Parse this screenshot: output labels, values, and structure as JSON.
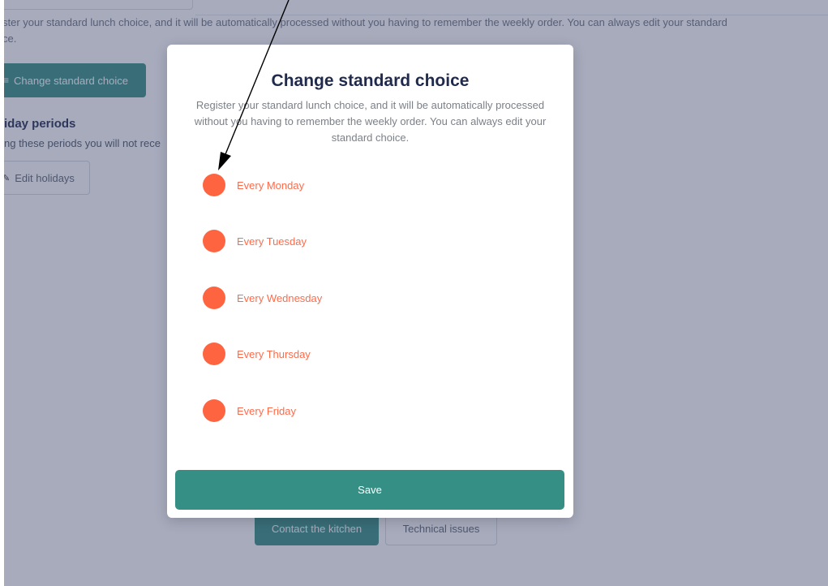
{
  "background": {
    "intro_line1": "ster your standard lunch choice, and it will be automatically processed without you having to remember the weekly order. You can always edit your standard",
    "intro_line2": "ce.",
    "change_standard_button": "Change standard choice",
    "change_standard_icon": "list-icon",
    "holiday_title": "iday periods",
    "holiday_desc": "ng these periods you will not rece",
    "edit_holidays_button": "Edit holidays",
    "edit_holidays_icon": "pencil-icon",
    "contact_kitchen_button": "Contact the kitchen",
    "technical_issues_button": "Technical issues"
  },
  "modal": {
    "title": "Change standard choice",
    "description": "Register your standard lunch choice, and it will be automatically processed without you having to remember the weekly order. You can always edit your standard choice.",
    "days": [
      {
        "label": "Every Monday"
      },
      {
        "label": "Every Tuesday"
      },
      {
        "label": "Every Wednesday"
      },
      {
        "label": "Every Thursday"
      },
      {
        "label": "Every Friday"
      }
    ],
    "save_button": "Save"
  },
  "colors": {
    "accent": "#358f84",
    "day_dot": "#ff6441",
    "day_label": "#ff6b4a",
    "heading": "#1f2a4d",
    "overlay": "rgba(63,71,110,0.46)"
  }
}
